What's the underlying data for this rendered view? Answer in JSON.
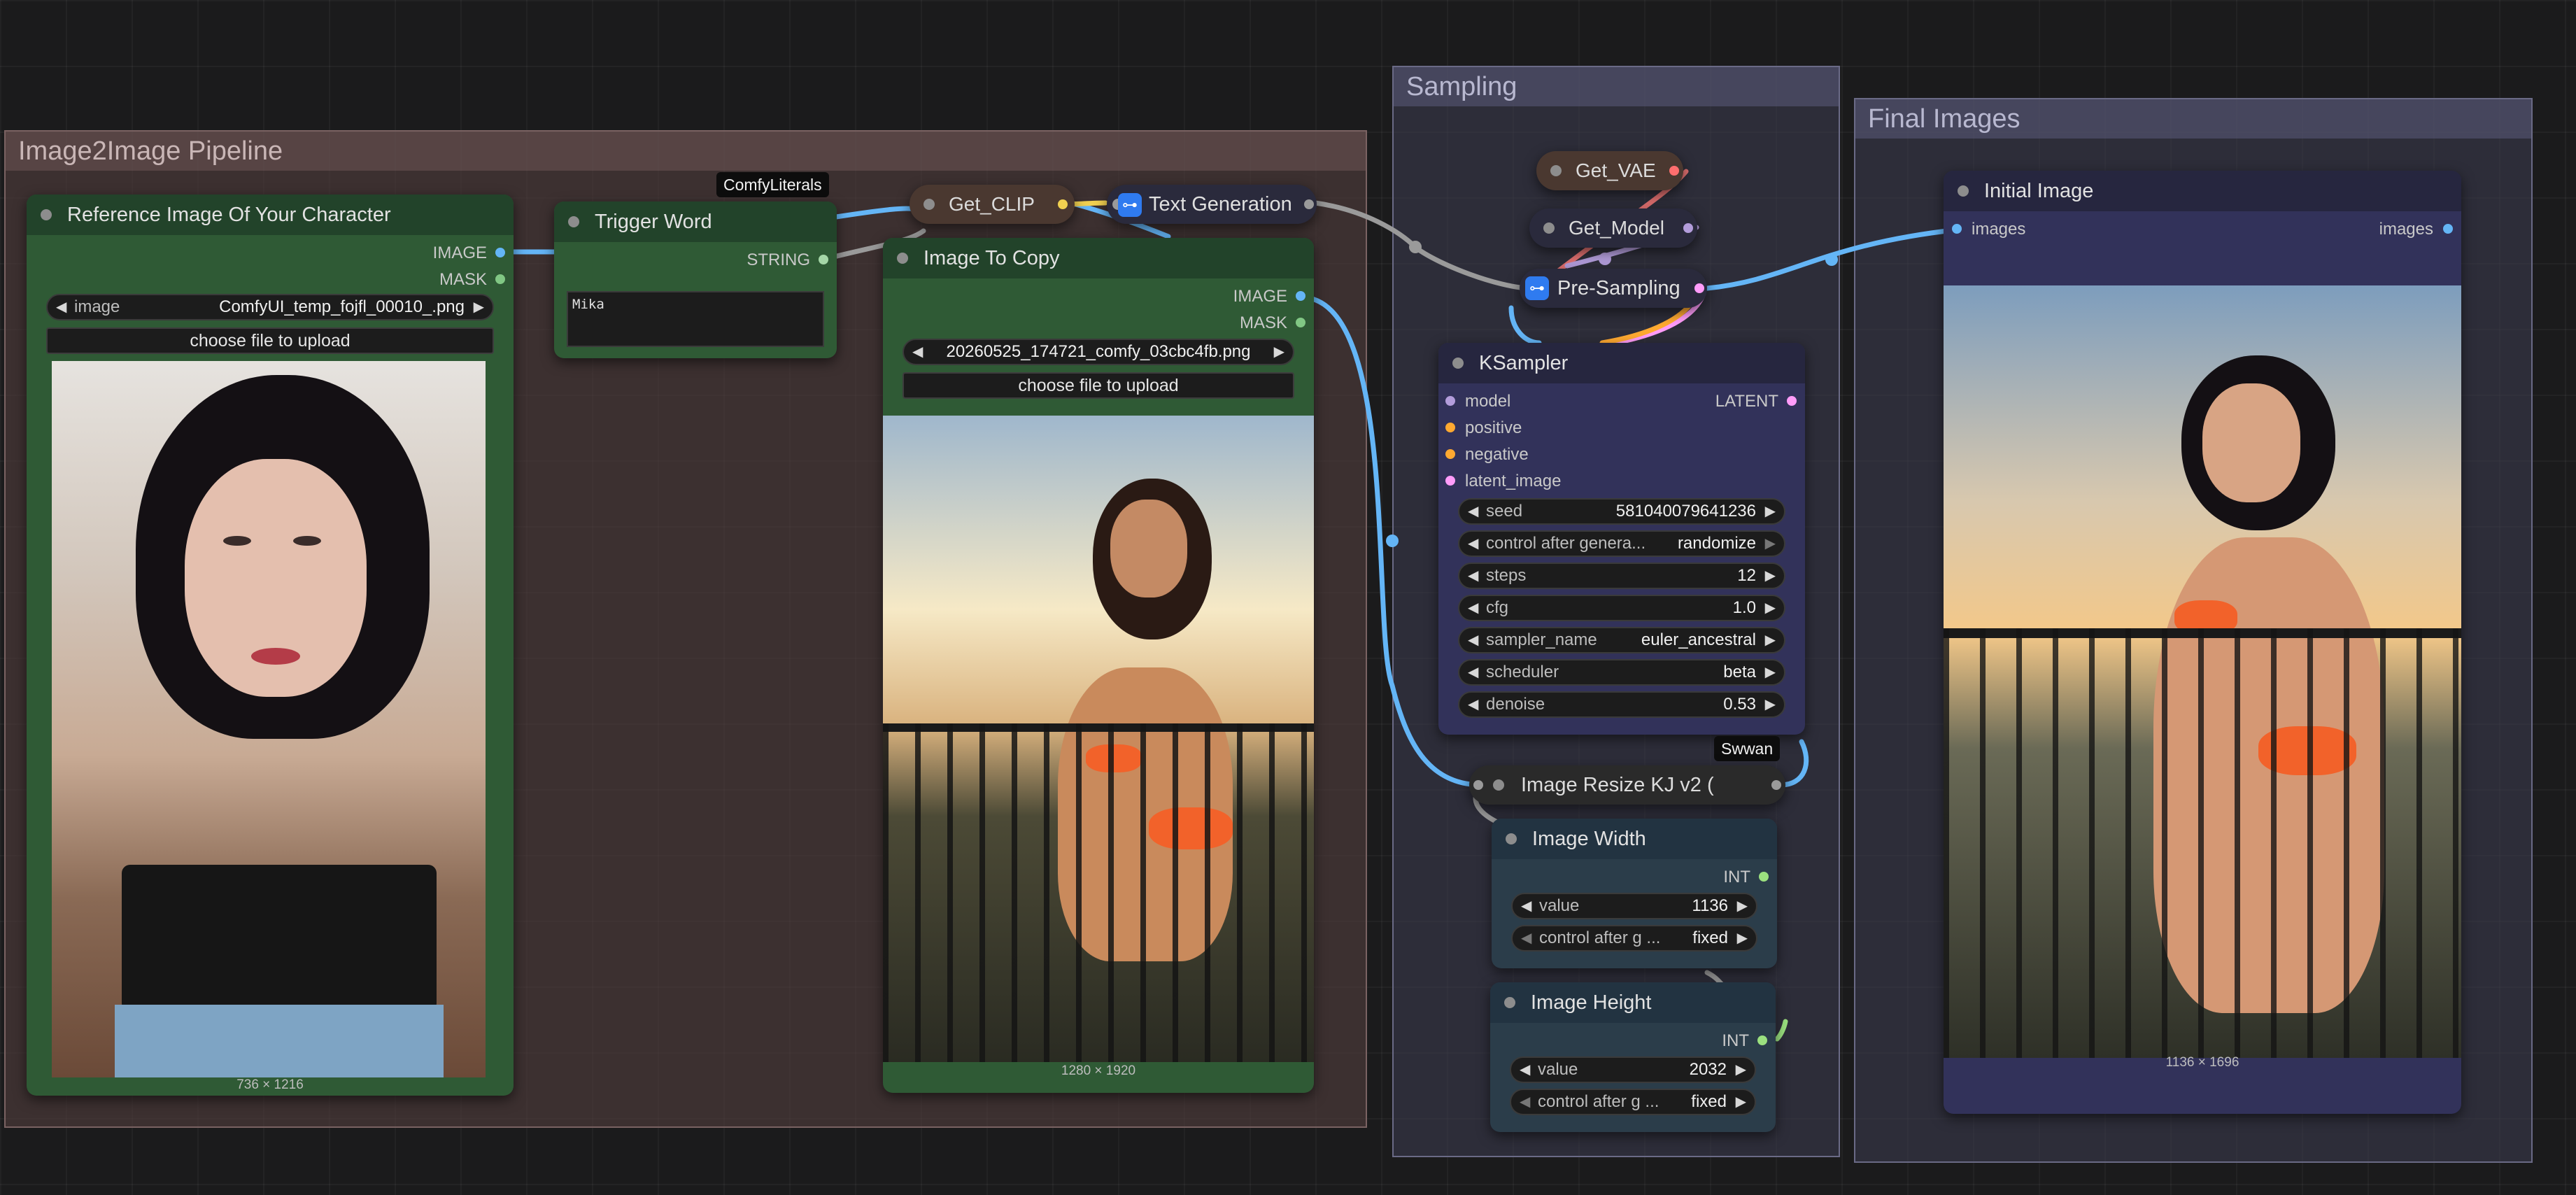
{
  "groups": {
    "pipeline": "Image2Image Pipeline",
    "sampling": "Sampling",
    "final": "Final Images"
  },
  "reference_node": {
    "title": "Reference Image Of Your Character",
    "out_image": "IMAGE",
    "out_mask": "MASK",
    "image_label": "image",
    "image_value": "ComfyUI_temp_fojfl_00010_.png",
    "upload": "choose file to upload",
    "dims": "736 × 1216"
  },
  "trigger_node": {
    "title": "Trigger Word",
    "badge": "ComfyLiterals",
    "out_string": "STRING",
    "text": "Mika"
  },
  "get_clip": {
    "title": "Get_CLIP"
  },
  "text_gen": {
    "title": "Text Generation"
  },
  "copy_node": {
    "title": "Image To Copy",
    "out_image": "IMAGE",
    "out_mask": "MASK",
    "image_value": "20260525_174721_comfy_03cbc4fb.png",
    "upload": "choose file to upload",
    "dims": "1280 × 1920"
  },
  "get_vae": {
    "title": "Get_VAE"
  },
  "get_model": {
    "title": "Get_Model"
  },
  "pre_sampling": {
    "title": "Pre-Sampling"
  },
  "ksampler": {
    "title": "KSampler",
    "inputs": [
      "model",
      "positive",
      "negative",
      "latent_image"
    ],
    "output": "LATENT",
    "widgets": [
      {
        "label": "seed",
        "value": "581040079641236"
      },
      {
        "label": "control after genera...",
        "value": "randomize"
      },
      {
        "label": "steps",
        "value": "12"
      },
      {
        "label": "cfg",
        "value": "1.0"
      },
      {
        "label": "sampler_name",
        "value": "euler_ancestral"
      },
      {
        "label": "scheduler",
        "value": "beta"
      },
      {
        "label": "denoise",
        "value": "0.53"
      }
    ]
  },
  "swwan_badge": "Swwan",
  "resize_node": {
    "title": "Image Resize KJ v2 ("
  },
  "width_node": {
    "title": "Image Width",
    "out": "INT",
    "value_label": "value",
    "value": "1136",
    "control_label": "control after g ...",
    "control_value": "fixed"
  },
  "height_node": {
    "title": "Image Height",
    "out": "INT",
    "value_label": "value",
    "value": "2032",
    "control_label": "control after g ...",
    "control_value": "fixed"
  },
  "initial_node": {
    "title": "Initial Image",
    "in_images": "images",
    "out_images": "images",
    "dims": "1136 × 1696"
  },
  "colors": {
    "pipeline_group": "#4a3c3c",
    "sampling_group": "#3a3a4c",
    "green_node": "#2f5a35",
    "purple_node": "#32325a",
    "image_socket": "#64b5f6",
    "int_socket": "#9be07f",
    "latent_socket": "#ff9cf9",
    "cond_socket": "#ffa931",
    "model_socket": "#b39ddb"
  }
}
